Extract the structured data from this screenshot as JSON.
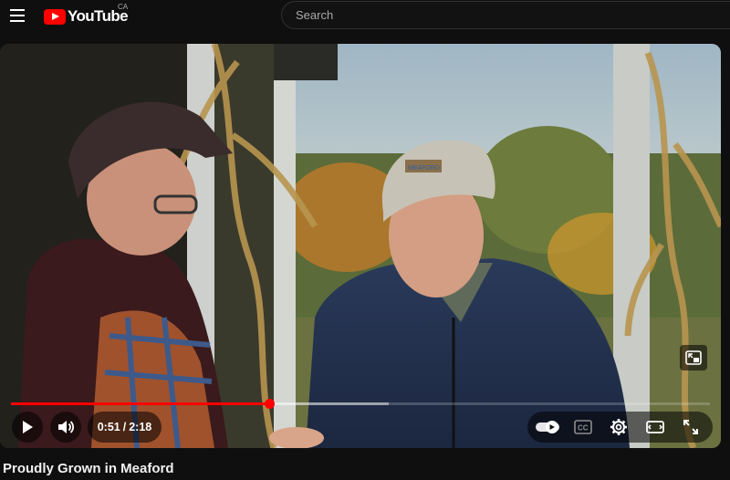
{
  "header": {
    "logo_text": "YouTube",
    "country_code": "CA",
    "search_placeholder": "Search"
  },
  "player": {
    "current_time": "0:51",
    "time_separator": "/",
    "duration": "2:18",
    "progress_fraction": 0.37,
    "buffered_fraction": 0.54,
    "autoplay_on": true,
    "accent_color": "#ff0000"
  },
  "video": {
    "title": "Proudly Grown in Meaford",
    "cap_logo_text": "MEAFORD"
  },
  "icons": {
    "menu": "hamburger-icon",
    "play": "play-icon",
    "volume": "volume-icon",
    "autoplay": "autoplay-toggle-icon",
    "captions": "captions-icon",
    "settings": "gear-icon",
    "theater": "theater-mode-icon",
    "fullscreen": "fullscreen-icon",
    "pip": "miniplayer-icon"
  }
}
